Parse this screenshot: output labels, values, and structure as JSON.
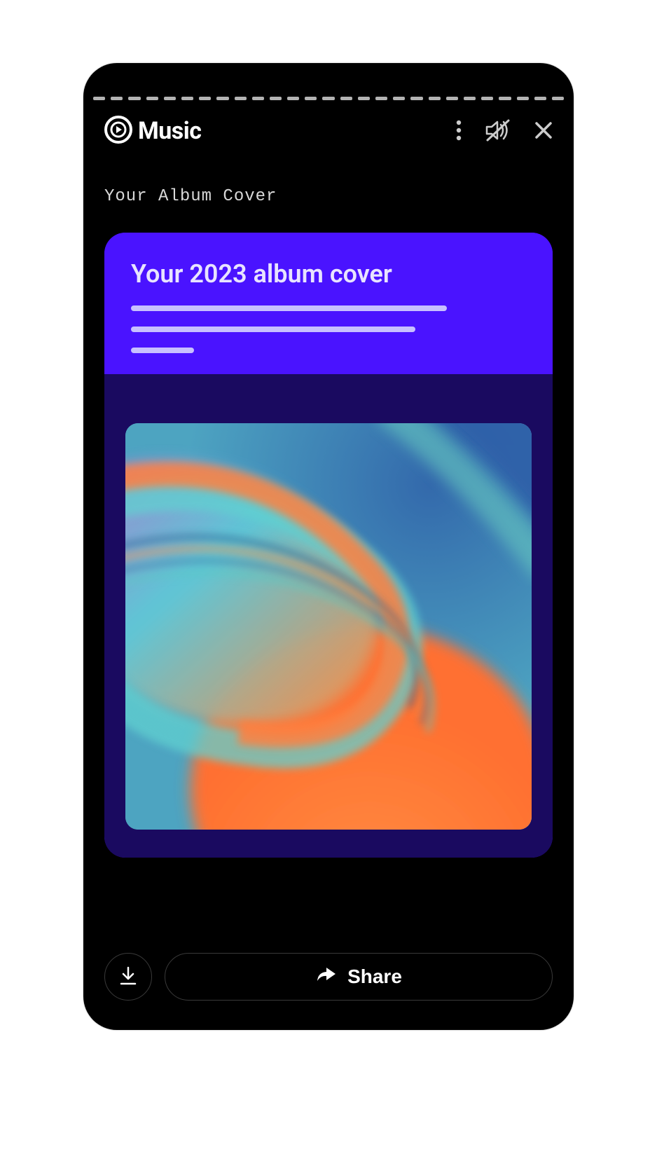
{
  "header": {
    "app_name": "Music"
  },
  "page": {
    "subtitle": "Your Album Cover"
  },
  "card": {
    "title": "Your 2023 album cover"
  },
  "actions": {
    "share_label": "Share"
  },
  "icons": {
    "logo": "music-play-icon",
    "more": "more-vert-icon",
    "mute": "volume-off-icon",
    "close": "close-icon",
    "download": "download-icon",
    "share": "share-arrow-icon"
  },
  "colors": {
    "card_primary": "#4a13ff",
    "card_secondary": "#1a0a60",
    "accent_text": "#e8e3ff"
  }
}
